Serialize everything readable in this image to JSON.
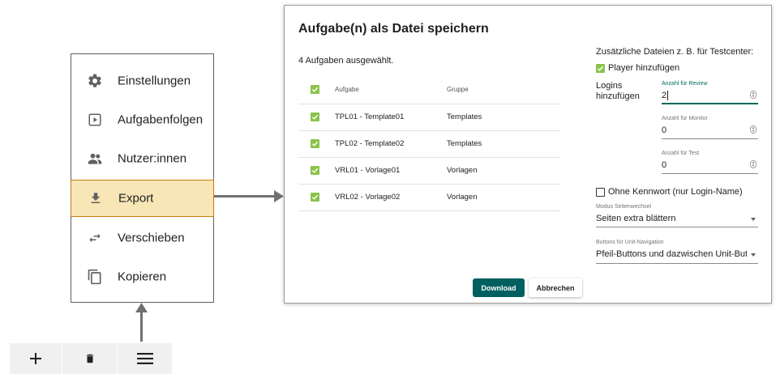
{
  "menu": {
    "items": [
      {
        "label": "Einstellungen",
        "icon": "gear-icon"
      },
      {
        "label": "Aufgabenfolgen",
        "icon": "play-box-icon"
      },
      {
        "label": "Nutzer:innen",
        "icon": "users-icon"
      },
      {
        "label": "Export",
        "icon": "download-icon",
        "active": true
      },
      {
        "label": "Verschieben",
        "icon": "move-arrows-icon"
      },
      {
        "label": "Kopieren",
        "icon": "copy-icon"
      }
    ]
  },
  "toolbar": {
    "add_icon": "plus-icon",
    "delete_icon": "trash-icon",
    "menu_icon": "hamburger-menu-icon"
  },
  "dialog": {
    "title": "Aufgabe(n) als Datei speichern",
    "selected_count_text": "4 Aufgaben ausgewählt.",
    "table": {
      "headers": [
        "Aufgabe",
        "Gruppe"
      ],
      "rows": [
        {
          "aufgabe": "TPL01 - Template01",
          "gruppe": "Templates"
        },
        {
          "aufgabe": "TPL02 - Template02",
          "gruppe": "Templates"
        },
        {
          "aufgabe": "VRL01 - Vorlage01",
          "gruppe": "Vorlagen"
        },
        {
          "aufgabe": "VRL02 - Vorlage02",
          "gruppe": "Vorlagen"
        }
      ]
    },
    "right": {
      "extra_files_heading": "Zusätzliche Dateien z. B. für Testcenter:",
      "player_label": "Player hinzufügen",
      "logins_label_1": "Logins",
      "logins_label_2": "hinzufügen",
      "review_label": "Anzahl für Review",
      "review_value": "2",
      "monitor_label": "Anzahl für Monitor",
      "monitor_value": "0",
      "test_label": "Anzahl für Test",
      "test_value": "0",
      "no_password_label": "Ohne Kennwort (nur Login-Name)",
      "page_mode_label": "Modus Seitenwechsel",
      "page_mode_value": "Seiten extra blättern",
      "nav_buttons_label": "Buttons für Unit-Navigation",
      "nav_buttons_value": "Pfeil-Buttons und dazwischen Unit-But…"
    },
    "download_label": "Download",
    "cancel_label": "Abbrechen"
  },
  "colors": {
    "accent": "#005f5f",
    "checkbox": "#8bc34a",
    "active_item_bg": "#f8e6b6",
    "active_item_border": "#c77c10"
  }
}
